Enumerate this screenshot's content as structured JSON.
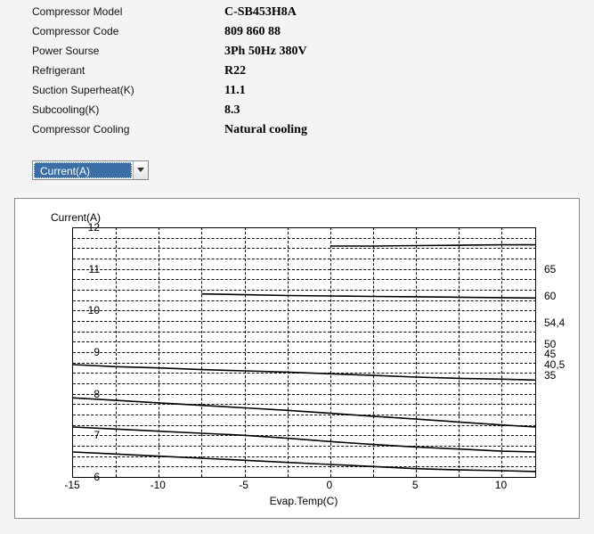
{
  "specs": [
    {
      "label": "Compressor  Model",
      "value": "C-SB453H8A"
    },
    {
      "label": "Compressor Code",
      "value": "809 860 88"
    },
    {
      "label": "Power Sourse",
      "value": "3Ph  50Hz  380V"
    },
    {
      "label": "Refrigerant",
      "value": "R22"
    },
    {
      "label": "Suction Superheat(K)",
      "value": "11.1"
    },
    {
      "label": "Subcooling(K)",
      "value": "8.3"
    },
    {
      "label": "Compressor Cooling",
      "value": "Natural cooling"
    }
  ],
  "dropdown": {
    "selected": "Current(A)"
  },
  "chart_data": {
    "type": "line",
    "title": "Current(A)",
    "xlabel": "Evap.Temp(C)",
    "ylabel": "",
    "xlim": [
      -15,
      12
    ],
    "ylim": [
      6,
      12
    ],
    "x": [
      -15,
      -12.5,
      -10,
      -7.5,
      -5,
      -2.5,
      0,
      2.5,
      5,
      7.5,
      10,
      12
    ],
    "xticks": [
      -15,
      -10,
      -5,
      0,
      5,
      10
    ],
    "yticks": [
      6,
      7,
      8,
      9,
      10,
      11,
      12
    ],
    "series_labels_x": 12.5,
    "series": [
      {
        "name": "35",
        "y": [
          6.6,
          6.55,
          6.5,
          6.45,
          6.4,
          6.35,
          6.3,
          6.25,
          6.2,
          6.17,
          6.15,
          6.13
        ]
      },
      {
        "name": "40,5",
        "y": [
          7.2,
          7.15,
          7.1,
          7.05,
          7.0,
          6.93,
          6.85,
          6.78,
          6.72,
          6.67,
          6.62,
          6.6
        ]
      },
      {
        "name": "45",
        "y": [
          7.9,
          7.84,
          7.78,
          7.72,
          7.66,
          7.6,
          7.53,
          7.46,
          7.39,
          7.32,
          7.25,
          7.2
        ]
      },
      {
        "name": "50",
        "y": [
          8.7,
          8.65,
          8.62,
          8.58,
          8.55,
          8.52,
          8.48,
          8.44,
          8.4,
          8.37,
          8.35,
          8.33
        ]
      },
      {
        "name": "54,4",
        "y": [
          null,
          null,
          null,
          10.4,
          10.38,
          10.36,
          10.35,
          10.34,
          10.33,
          10.32,
          10.31,
          10.3
        ]
      },
      {
        "name": "60",
        "y": [
          null,
          null,
          null,
          null,
          null,
          null,
          11.55,
          11.55,
          11.56,
          11.57,
          11.58,
          11.58
        ]
      },
      {
        "name": "65",
        "label_only": true
      }
    ],
    "series_label_y": {
      "35": 8.45,
      "40,5": 8.7,
      "45": 8.95,
      "50": 9.2,
      "54,4": 9.7,
      "60": 10.35,
      "65": 11.0
    }
  }
}
